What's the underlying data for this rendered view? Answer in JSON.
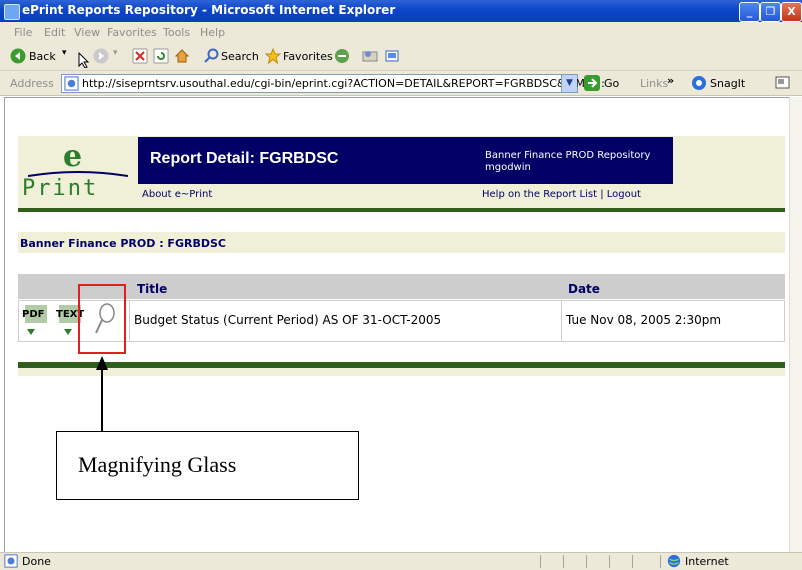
{
  "window": {
    "title": "ePrint Reports Repository - Microsoft Internet Explorer",
    "minimize": "_",
    "maximize": "❐",
    "close": "X"
  },
  "menu": [
    "File",
    "Edit",
    "View",
    "Favorites",
    "Tools",
    "Help"
  ],
  "toolbar": {
    "back": "Back",
    "search": "Search",
    "favorites": "Favorites"
  },
  "address": {
    "label": "Address",
    "url": "http://siseprntsrv.usouthal.edu/cgi-bin/eprint.cgi?ACTION=DETAIL&REPORT=FGRBDSC&TIME=:",
    "go": "Go",
    "links": "Links",
    "links_more": "»",
    "snagit": "SnagIt"
  },
  "header": {
    "logo_e": "e",
    "logo_print": "Print",
    "report_title": "Report Detail: FGRBDSC",
    "repository": "Banner Finance PROD Repository",
    "user": "mgodwin",
    "about": "About e~Print",
    "help": "Help on the Report List | Logout"
  },
  "breadcrumb": "Banner Finance PROD : FGRBDSC",
  "table": {
    "columns": {
      "title": "Title",
      "date": "Date"
    },
    "rows": [
      {
        "formats": [
          "PDF",
          "TEXT"
        ],
        "title": "Budget Status (Current Period) AS OF 31-OCT-2005",
        "date": "Tue Nov 08, 2005 2:30pm"
      }
    ]
  },
  "annotation": {
    "label": "Magnifying Glass"
  },
  "status": {
    "text": "Done",
    "zone": "Internet"
  },
  "colors": {
    "header_navy": "#000066",
    "brand_green": "#2b7d2b",
    "rule_green": "#2f5f1b",
    "band_beige": "#f0efd8",
    "highlight_red": "#e02020"
  }
}
